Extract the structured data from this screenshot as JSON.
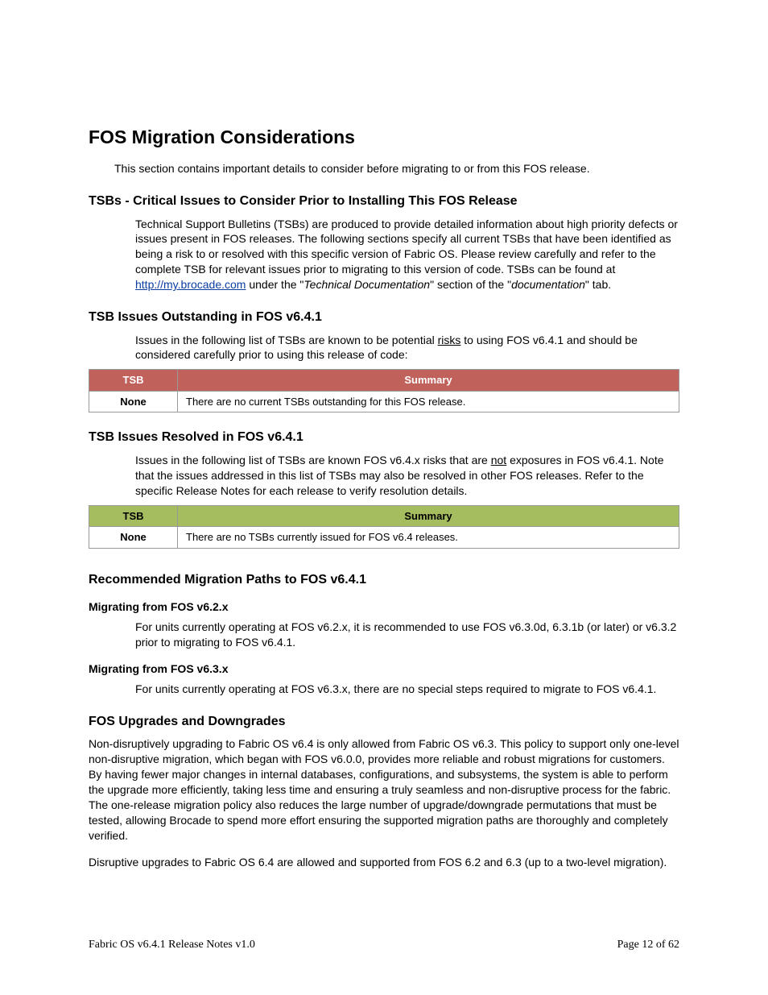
{
  "h1": "FOS Migration Considerations",
  "intro": "This section contains important details to consider before migrating to or from this FOS release.",
  "tsbs": {
    "heading": "TSBs - Critical Issues to Consider Prior to Installing This FOS Release",
    "para_pre": "Technical Support Bulletins (TSBs) are produced to provide detailed information about high priority defects or issues present in FOS releases.  The following sections specify all current TSBs that have been identified as being a risk to or resolved with this specific version of Fabric OS.  Please review carefully and refer to the complete TSB for relevant issues prior to migrating to this version of code.  TSBs can be found at ",
    "link": "http://my.brocade.com",
    "para_mid": " under the \"",
    "italic1": "Technical Documentation",
    "para_mid2": "\" section of the \"",
    "italic2": "documentation",
    "para_post": "\" tab."
  },
  "outstanding": {
    "heading": "TSB Issues Outstanding in FOS v6.4.1",
    "para_pre": "Issues in the following list of TSBs are known to be potential ",
    "risks": "risks",
    "para_post": " to using FOS v6.4.1 and should be considered carefully prior to using this release of code:",
    "col1": "TSB",
    "col2": "Summary",
    "cell1": "None",
    "cell2": "There are no current TSBs outstanding for this FOS release."
  },
  "resolved": {
    "heading": "TSB Issues Resolved in FOS v6.4.1",
    "para_pre": "Issues in the following list of TSBs are known FOS v6.4.x risks that are ",
    "not": "not",
    "para_post": " exposures in FOS v6.4.1. Note that the issues addressed in this list of TSBs may also be resolved in other FOS releases.  Refer to the specific Release Notes for each release to verify resolution details.",
    "col1": "TSB",
    "col2": "Summary",
    "cell1": "None",
    "cell2": "There are no TSBs currently issued for FOS v6.4 releases."
  },
  "paths": {
    "heading": "Recommended Migration Paths to FOS v6.4.1",
    "sub1": "Migrating from FOS v6.2.x",
    "p1": "For units currently operating at FOS v6.2.x, it is recommended to use FOS v6.3.0d, 6.3.1b (or later) or v6.3.2 prior to migrating to FOS v6.4.1.",
    "sub2": "Migrating from FOS v6.3.x",
    "p2": "For units currently operating at FOS v6.3.x, there are no special steps required to migrate to FOS v6.4.1."
  },
  "upgrades": {
    "heading": "FOS Upgrades and Downgrades",
    "p1": "Non-disruptively upgrading to Fabric OS v6.4 is only allowed from Fabric OS v6.3.  This policy to support only one-level non-disruptive migration, which began with FOS v6.0.0, provides more reliable and robust migrations for customers.  By having fewer major changes in internal databases, configurations, and subsystems, the system is able to perform the upgrade more efficiently, taking less time and ensuring a truly seamless and non-disruptive process for the fabric.  The one-release migration policy also reduces the large number of upgrade/downgrade permutations that must be tested, allowing Brocade to spend more effort ensuring the supported migration paths are thoroughly and completely verified.",
    "p2": "Disruptive upgrades to Fabric OS 6.4 are allowed and supported from FOS 6.2 and 6.3 (up to a two-level migration)."
  },
  "footer": {
    "left": "Fabric OS v6.4.1 Release Notes v1.0",
    "right": "Page 12 of 62"
  }
}
